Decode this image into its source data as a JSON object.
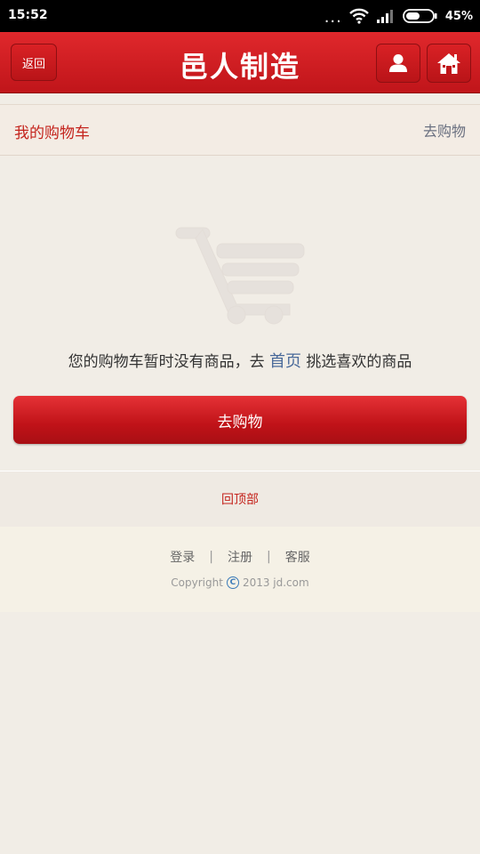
{
  "status_bar": {
    "time": "15:52",
    "dots": "...",
    "battery": "45%"
  },
  "header": {
    "back_label": "返回",
    "title": "邑人制造",
    "user_icon": "user-icon",
    "home_icon": "home-icon"
  },
  "cart_bar": {
    "title": "我的购物车",
    "go_shopping": "去购物"
  },
  "empty": {
    "msg_before": "您的购物车暂时没有商品，去",
    "home_link": "首页",
    "msg_after": "挑选喜欢的商品",
    "illustration_icon": "shopping-cart-icon"
  },
  "shop_button_label": "去购物",
  "back_to_top": "回顶部",
  "footer": {
    "login": "登录",
    "register": "注册",
    "service": "客服",
    "sep": "|",
    "copyright_before": "Copyright",
    "copyright_symbol": "C",
    "copyright_after": "2013 jd.com"
  },
  "colors": {
    "brand_red": "#c0151a",
    "link_blue": "#4a6a9a"
  }
}
